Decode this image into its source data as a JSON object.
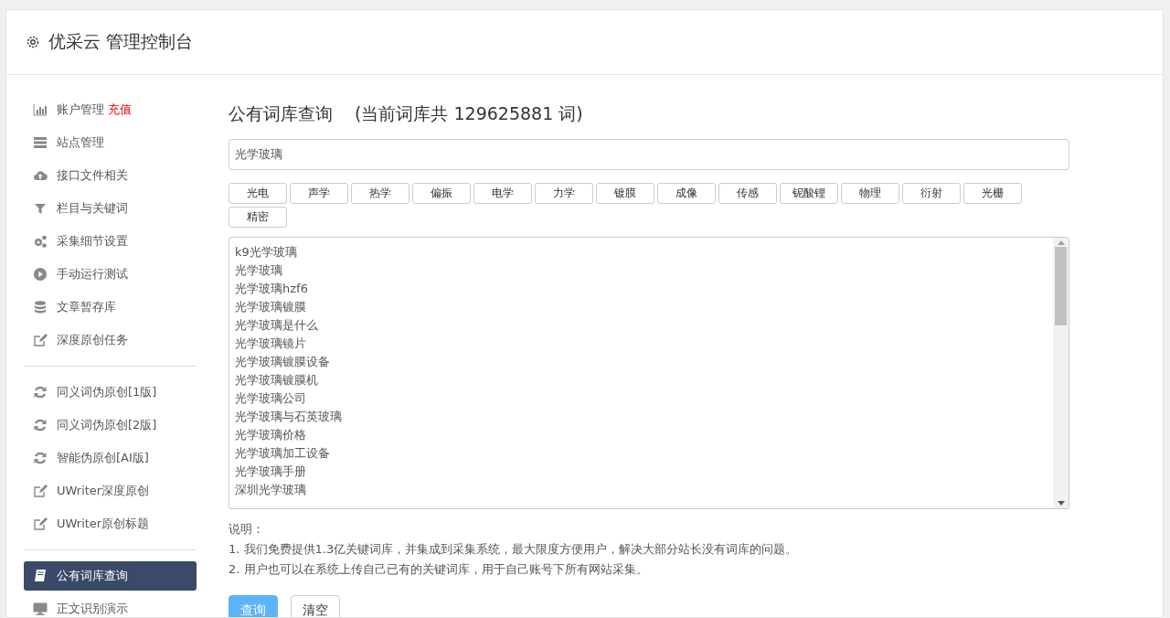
{
  "header": {
    "title": "优采云 管理控制台"
  },
  "sidebar": {
    "groups": [
      {
        "items": [
          {
            "label": "账户管理",
            "badge": "充值",
            "kind": "chart",
            "selected": false
          },
          {
            "label": "站点管理",
            "kind": "server",
            "selected": false
          },
          {
            "label": "接口文件相关",
            "kind": "cloud",
            "selected": false
          },
          {
            "label": "栏目与关键词",
            "kind": "filter",
            "selected": false
          },
          {
            "label": "采集细节设置",
            "kind": "gears",
            "selected": false
          },
          {
            "label": "手动运行测试",
            "kind": "play",
            "selected": false
          },
          {
            "label": "文章暂存库",
            "kind": "database",
            "selected": false
          },
          {
            "label": "深度原创任务",
            "kind": "edit",
            "selected": false
          }
        ]
      },
      {
        "items": [
          {
            "label": "同义词伪原创[1版]",
            "kind": "refresh",
            "selected": false
          },
          {
            "label": "同义词伪原创[2版]",
            "kind": "refresh",
            "selected": false
          },
          {
            "label": "智能伪原创[AI版]",
            "kind": "refresh",
            "selected": false
          },
          {
            "label": "UWriter深度原创",
            "kind": "edit",
            "selected": false
          },
          {
            "label": "UWriter原创标题",
            "kind": "edit",
            "selected": false
          }
        ]
      },
      {
        "items": [
          {
            "label": "公有词库查询",
            "kind": "book",
            "selected": true
          },
          {
            "label": "正文识别演示",
            "kind": "monitor",
            "selected": false
          }
        ]
      }
    ]
  },
  "main": {
    "title": "公有词库查询",
    "subtitle": "(当前词库共 129625881 词)",
    "search": {
      "value": "光学玻璃"
    },
    "tags": [
      "光电",
      "声学",
      "热学",
      "偏振",
      "电学",
      "力学",
      "镀膜",
      "成像",
      "传感",
      "铌酸锂",
      "物理",
      "衍射",
      "光栅",
      "精密"
    ],
    "results": [
      "k9光学玻璃",
      "光学玻璃",
      "光学玻璃hzf6",
      "光学玻璃镀膜",
      "光学玻璃是什么",
      "光学玻璃镜片",
      "光学玻璃镀膜设备",
      "光学玻璃镀膜机",
      "光学玻璃公司",
      "光学玻璃与石英玻璃",
      "光学玻璃价格",
      "光学玻璃加工设备",
      "光学玻璃手册",
      "深圳光学玻璃"
    ],
    "notes_title": "说明：",
    "notes": [
      "1. 我们免费提供1.3亿关键词库，并集成到采集系统，最大限度方便用户，解决大部分站长没有词库的问题。",
      "2. 用户也可以在系统上传自己已有的关键词库，用于自己账号下所有网站采集。"
    ],
    "buttons": [
      {
        "label": "查询",
        "kind": "primary"
      },
      {
        "label": "清空",
        "kind": "default"
      }
    ]
  }
}
